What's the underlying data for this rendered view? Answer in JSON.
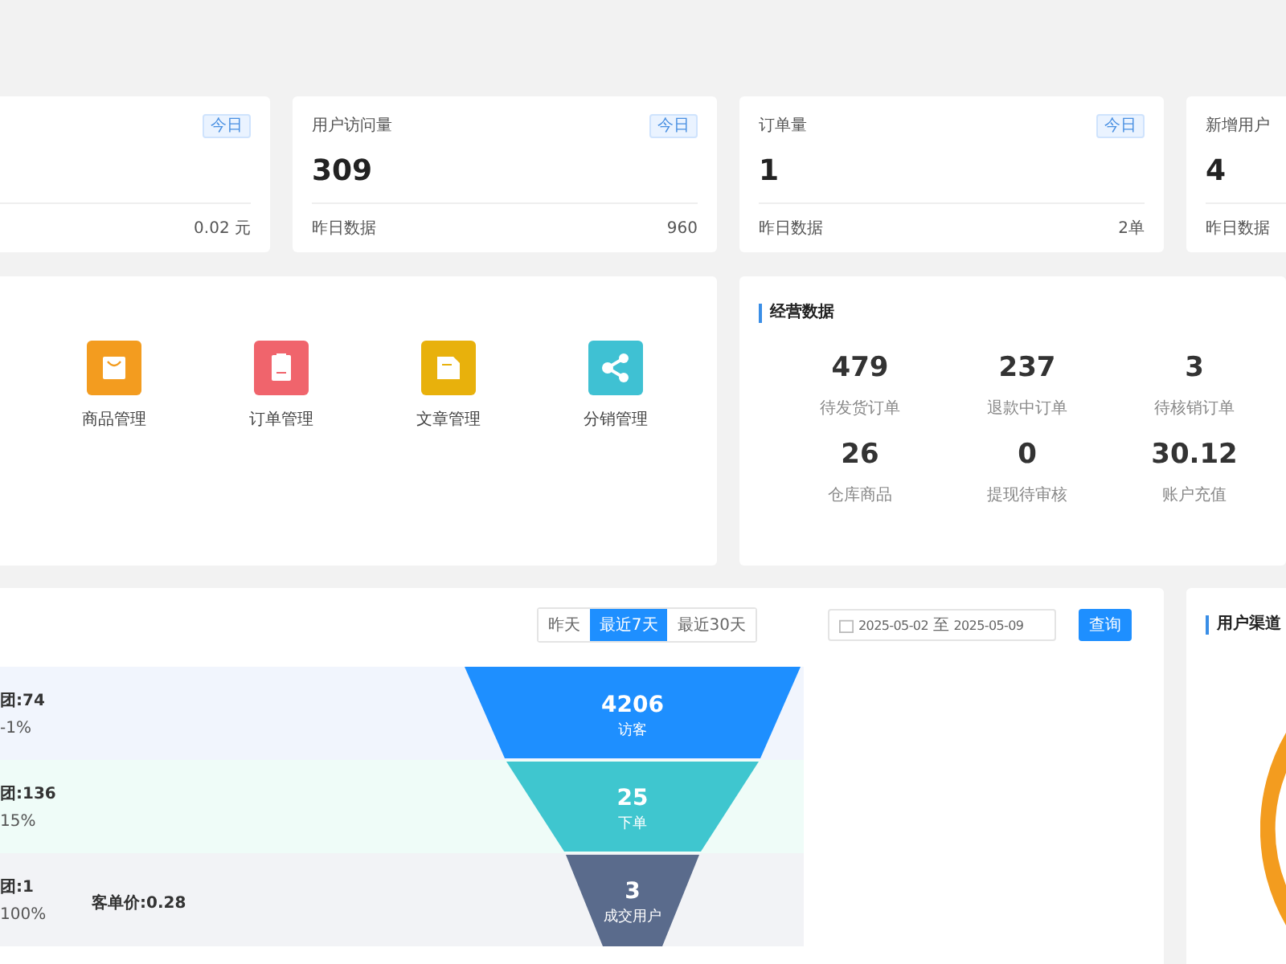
{
  "stat_cards": [
    {
      "badge": "今日",
      "footer_value": "0.02 元"
    },
    {
      "title": "用户访问量",
      "badge": "今日",
      "value": "309",
      "footer_label": "昨日数据",
      "footer_value": "960"
    },
    {
      "title": "订单量",
      "badge": "今日",
      "value": "1",
      "footer_label": "昨日数据",
      "footer_value": "2单"
    },
    {
      "title": "新增用户",
      "value": "4",
      "footer_label": "昨日数据"
    }
  ],
  "shortcuts": [
    {
      "kind": "bag",
      "label": "商品管理",
      "color": "#f39c1f"
    },
    {
      "kind": "clipboard",
      "label": "订单管理",
      "color": "#f0646c"
    },
    {
      "kind": "doc",
      "label": "文章管理",
      "color": "#e8b10c"
    },
    {
      "kind": "share",
      "label": "分销管理",
      "color": "#3fc1d3"
    }
  ],
  "business": {
    "title": "经营数据",
    "items": [
      {
        "value": "479",
        "label": "待发货订单"
      },
      {
        "value": "237",
        "label": "退款中订单"
      },
      {
        "value": "3",
        "label": "待核销订单"
      },
      {
        "value": "26",
        "label": "仓库商品"
      },
      {
        "value": "0",
        "label": "提现待审核"
      },
      {
        "value": "30.12",
        "label": "账户充值"
      }
    ]
  },
  "funnel_panel": {
    "ranges": [
      {
        "label": "昨天",
        "selected": false
      },
      {
        "label": "最近7天",
        "selected": true
      },
      {
        "label": "最近30天",
        "selected": false
      }
    ],
    "date_range": {
      "start": "2025-05-02",
      "separator": "至",
      "end": "2025-05-09"
    },
    "query_button": "查询",
    "stages": [
      {
        "line_1": "团:74",
        "line_2": "-1%",
        "value": "4206",
        "label": "访客",
        "color": "#1e8fff"
      },
      {
        "line_1": "团:136",
        "line_2": "15%",
        "value": "25",
        "label": "下单",
        "color": "#3fc6cf"
      },
      {
        "line_1": "团:1",
        "line_2": "100%",
        "extra": "客单价:0.28",
        "value": "3",
        "label": "成交用户",
        "color": "#5a6b8c"
      }
    ]
  },
  "channel_panel": {
    "title": "用户渠道"
  }
}
